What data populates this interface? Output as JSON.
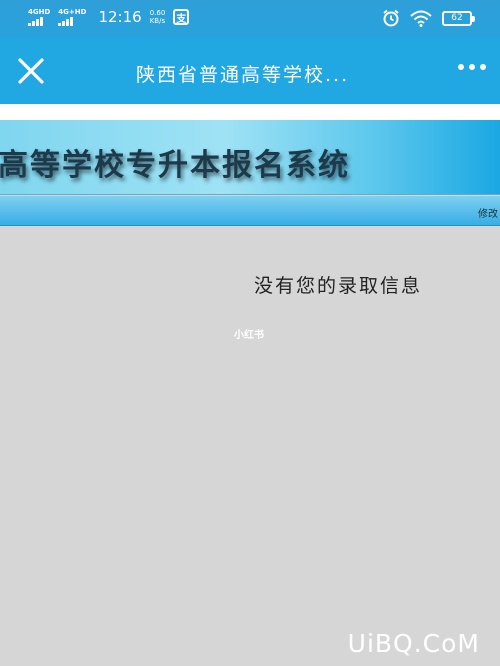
{
  "status_bar": {
    "network1": "4GHD",
    "network2": "4G+HD",
    "time": "12:16",
    "speed_value": "0.60",
    "speed_unit": "KB/s",
    "app_badge": "支",
    "battery": "62"
  },
  "nav": {
    "title": "陕西省普通高等学校..."
  },
  "banner": {
    "title": "高等学校专升本报名系统",
    "menu_link": "修改"
  },
  "content": {
    "message": "没有您的录取信息",
    "watermark_small": "小红书",
    "watermark_site": "UiBQ.CoM"
  },
  "colors": {
    "accent": "#21a7e2",
    "background": "#d6d6d6"
  },
  "icons": [
    "signal-icon",
    "wifi-icon",
    "alarm-icon",
    "battery-icon",
    "close-icon",
    "more-icon"
  ]
}
